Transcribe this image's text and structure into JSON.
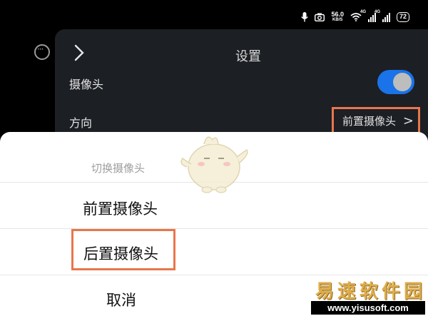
{
  "status_bar": {
    "speed_value": "56.0",
    "speed_unit": "KB/S",
    "signal_1_label": "4G",
    "signal_2_label": "4G",
    "battery": "72",
    "icons": [
      "mic-icon",
      "camera-icon",
      "wifi-icon",
      "signal-icon",
      "signal-icon",
      "battery-icon"
    ]
  },
  "settings": {
    "title": "设置",
    "camera_label": "摄像头",
    "camera_enabled": true,
    "direction_label": "方向",
    "direction_value": "前置摄像头"
  },
  "sheet": {
    "title": "切换摄像头",
    "options": [
      "前置摄像头",
      "后置摄像头"
    ],
    "cancel": "取消"
  },
  "watermark": {
    "brand_name": "易速软件园",
    "brand_url": "www.yisusoft.com"
  },
  "colors": {
    "highlight": "#e8764c",
    "toggle_on": "#1a73e8",
    "panel_bg": "#1c1f24",
    "brand_gold": "#e0ad4c"
  }
}
